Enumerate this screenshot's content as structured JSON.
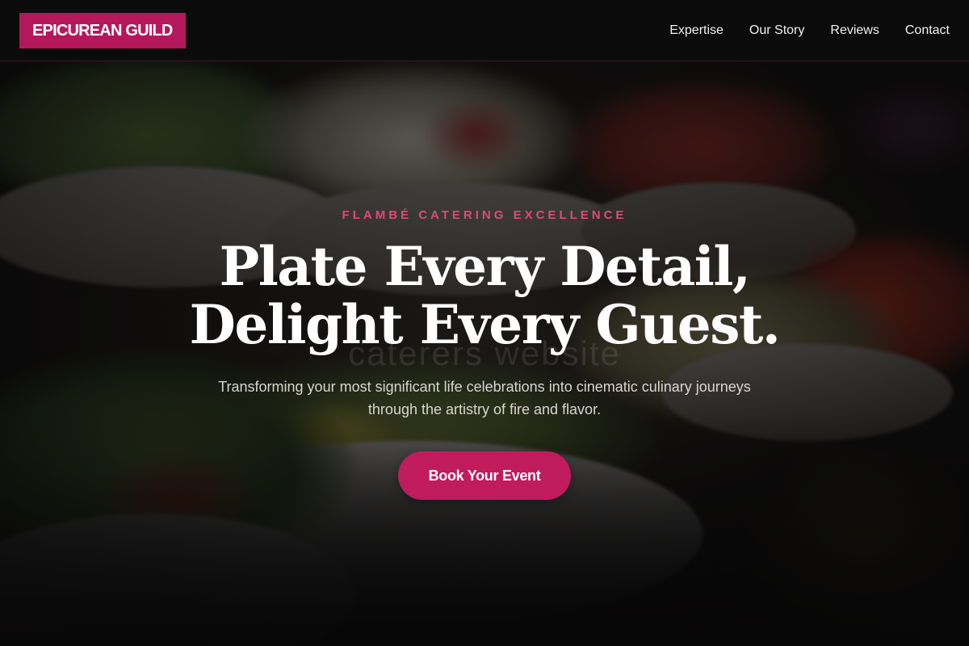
{
  "header": {
    "logo_text": "EPICUREAN GUILD",
    "nav": [
      {
        "label": "Expertise"
      },
      {
        "label": "Our Story"
      },
      {
        "label": "Reviews"
      },
      {
        "label": "Contact"
      }
    ]
  },
  "hero": {
    "eyebrow": "FLAMBÉ CATERING EXCELLENCE",
    "headline_line1": "Plate Every Detail,",
    "headline_line2": "Delight Every Guest.",
    "watermark": "caterers website",
    "subtext": "Transforming your most significant life celebrations into cinematic culinary journeys through the artistry of fire and flavor.",
    "cta_label": "Book Your Event"
  },
  "colors": {
    "brand": "#b5185a",
    "cta": "#c01c5d",
    "eyebrow": "#e0487e",
    "header_bg": "#0c0b0c",
    "page_bg": "#0b0a0b"
  }
}
